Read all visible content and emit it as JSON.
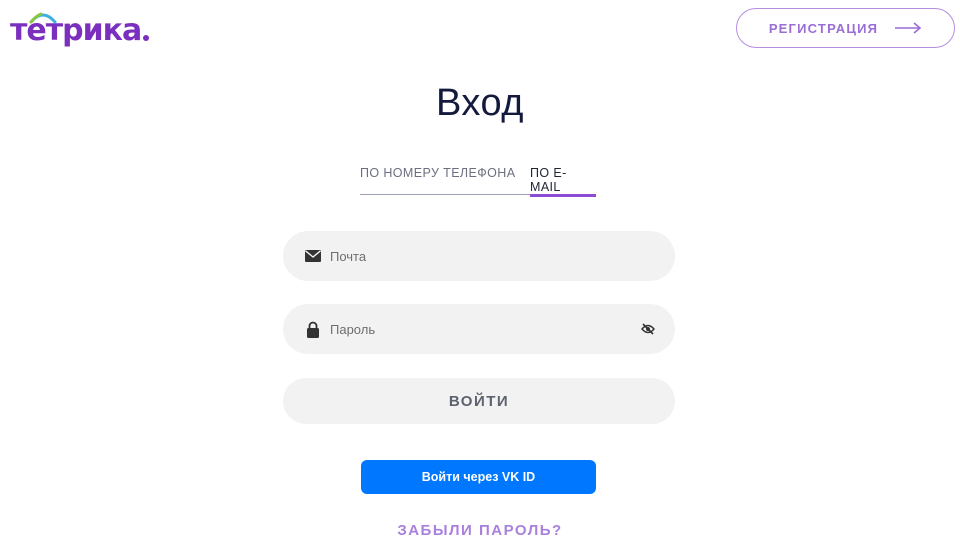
{
  "logo": {
    "text": "тетрика",
    "icon": "tetrika-logo-arc",
    "colors": {
      "primary": "#7b2fbe",
      "arc_blue": "#3ab0e0",
      "arc_green": "#8cc63f"
    }
  },
  "header": {
    "register_label": "РЕГИСТРАЦИЯ",
    "register_icon": "arrow-right-icon"
  },
  "main": {
    "title": "Вход",
    "tabs": [
      {
        "label": "ПО НОМЕРУ ТЕЛЕФОНА",
        "active": false
      },
      {
        "label": "ПО E-MAIL",
        "active": true
      }
    ],
    "email_field": {
      "placeholder": "Почта",
      "value": "",
      "icon": "envelope-icon"
    },
    "password_field": {
      "placeholder": "Пароль",
      "value": "",
      "icon": "lock-icon",
      "toggle_icon": "eye-off-icon"
    },
    "login_label": "ВОЙТИ",
    "vk_label": "Войти через VK ID",
    "forgot_label": "ЗАБЫЛИ ПАРОЛЬ?"
  },
  "colors": {
    "accent": "#8c4cd6",
    "title": "#141a3c",
    "vk_blue": "#0077ff",
    "field_bg": "#f2f2f2",
    "link": "#a980dc"
  }
}
